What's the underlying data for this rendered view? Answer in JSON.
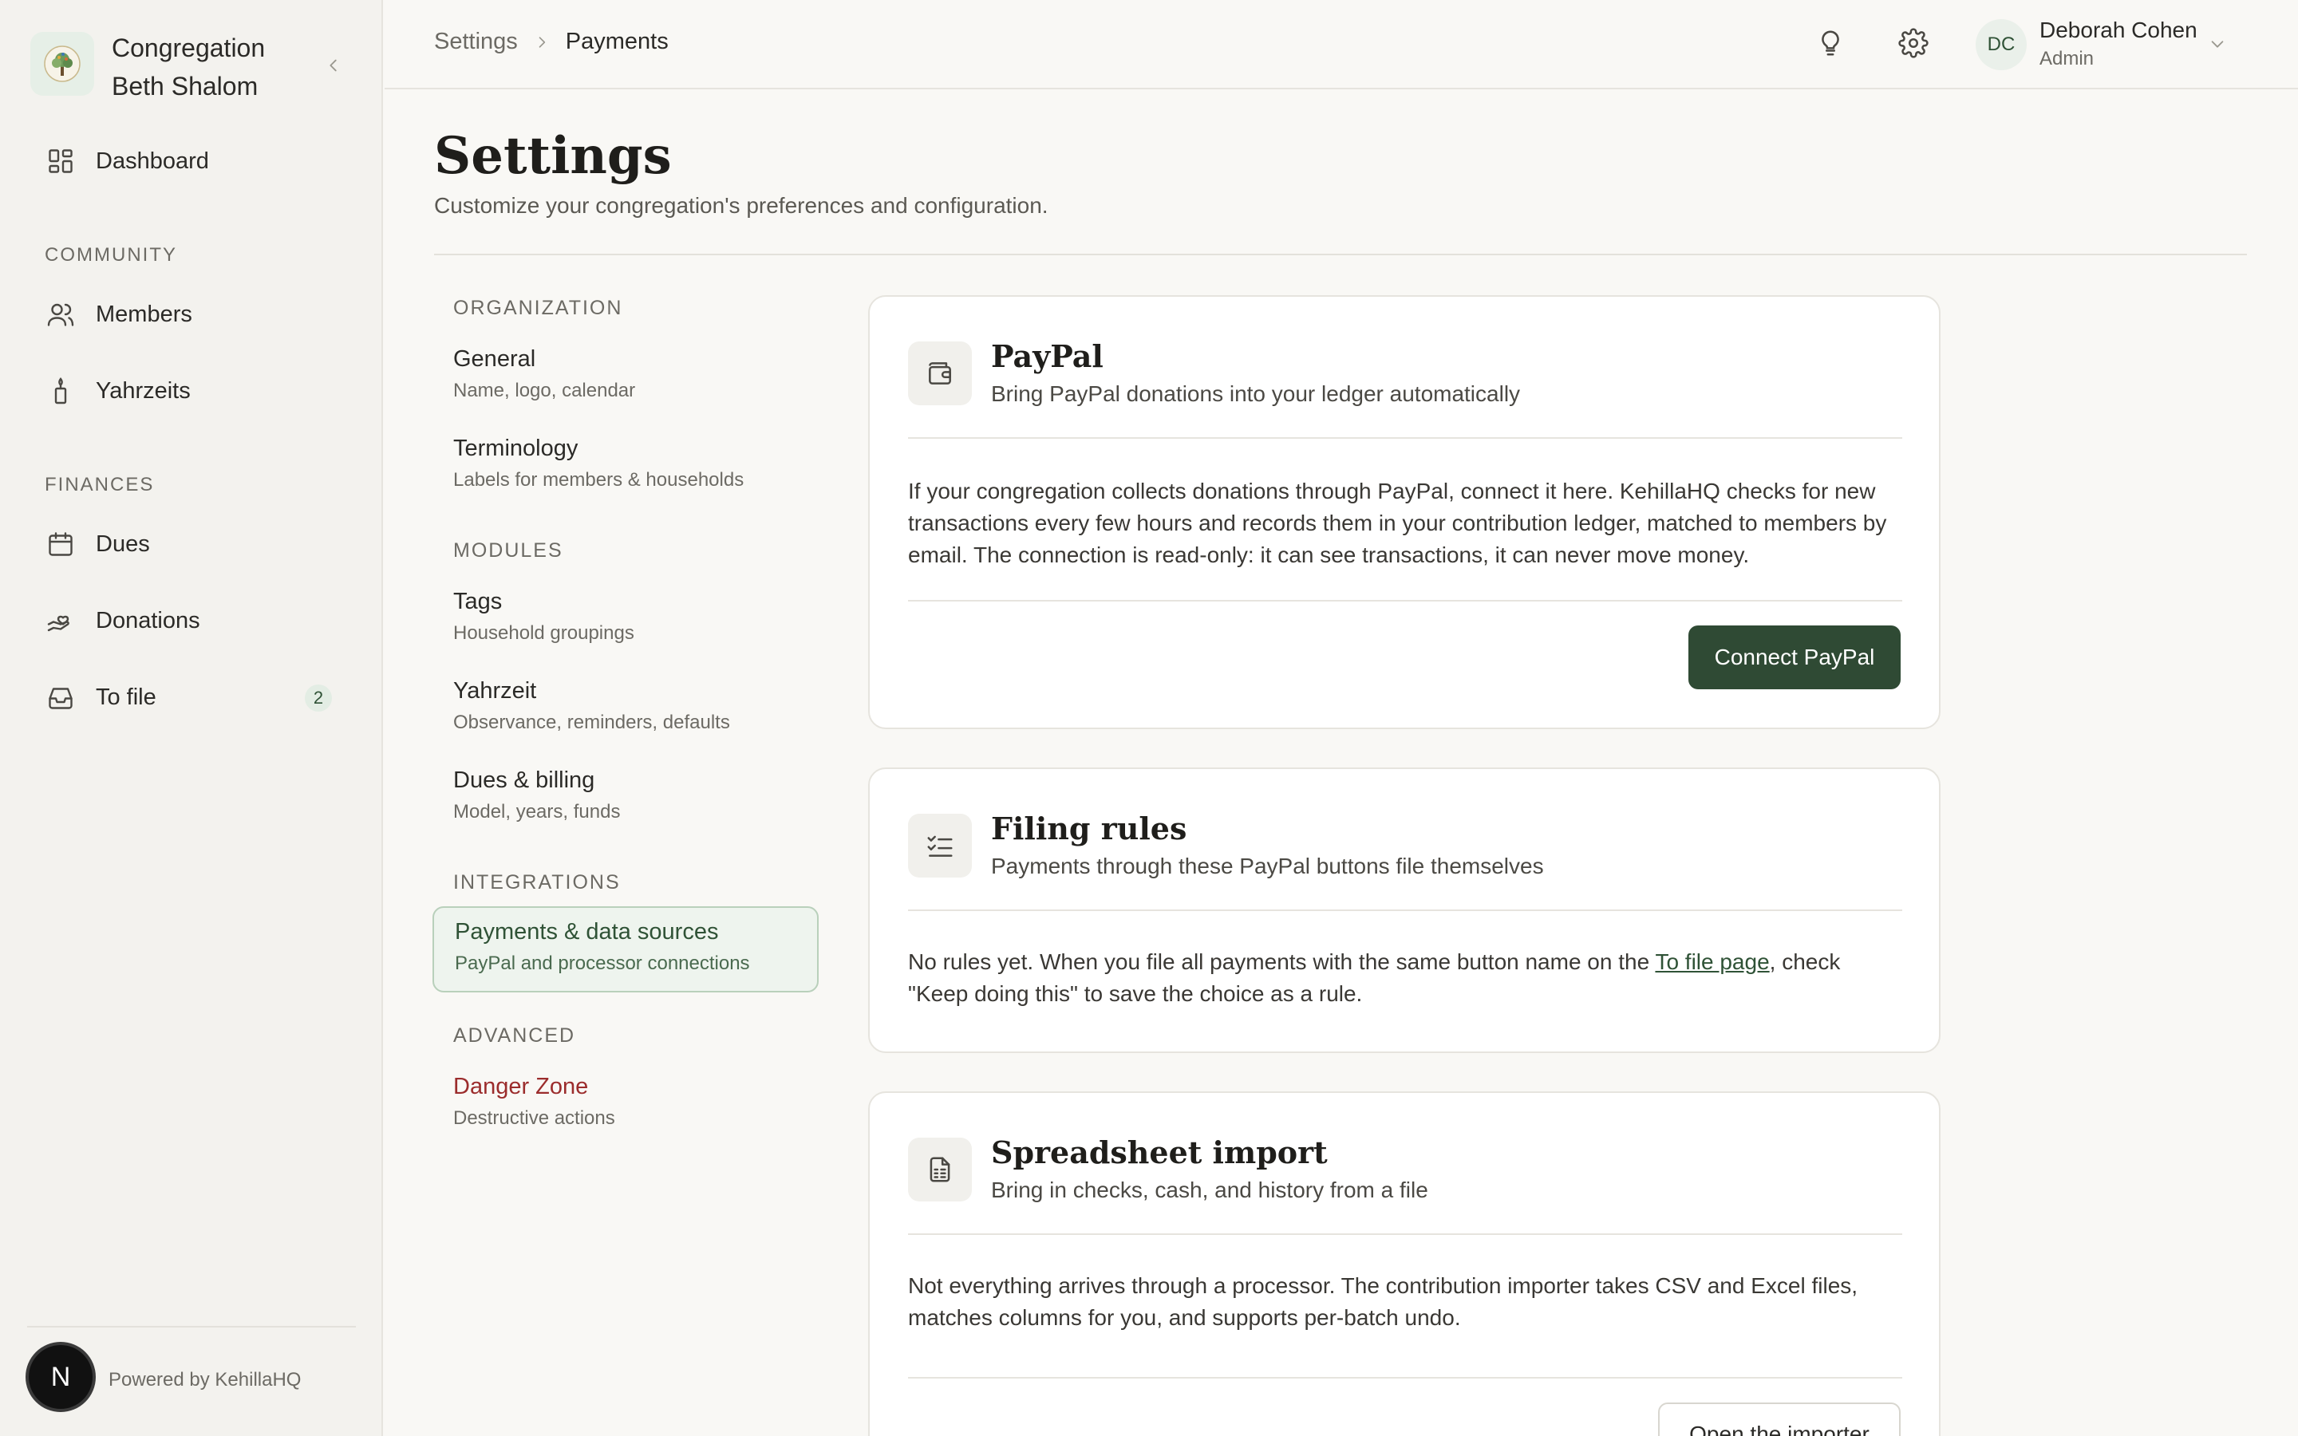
{
  "sidebar": {
    "org_name_line1": "Congregation",
    "org_name_line2": "Beth Shalom",
    "dashboard": "Dashboard",
    "section_community": "COMMUNITY",
    "members": "Members",
    "yahrzeits": "Yahrzeits",
    "section_finances": "FINANCES",
    "dues": "Dues",
    "donations": "Donations",
    "to_file": "To file",
    "to_file_count": "2",
    "avatar_letter": "N",
    "powered_by": "Powered by KehillaHQ"
  },
  "topbar": {
    "breadcrumb_root": "Settings",
    "breadcrumb_current": "Payments",
    "user_initials": "DC",
    "user_name": "Deborah Cohen",
    "user_role": "Admin"
  },
  "page": {
    "title": "Settings",
    "subtitle": "Customize your congregation's preferences and configuration."
  },
  "settings_nav": {
    "section_organization": "ORGANIZATION",
    "general_title": "General",
    "general_desc": "Name, logo, calendar",
    "terminology_title": "Terminology",
    "terminology_desc": "Labels for members & households",
    "section_modules": "MODULES",
    "tags_title": "Tags",
    "tags_desc": "Household groupings",
    "yahrzeit_title": "Yahrzeit",
    "yahrzeit_desc": "Observance, reminders, defaults",
    "dues_title": "Dues & billing",
    "dues_desc": "Model, years, funds",
    "section_integrations": "INTEGRATIONS",
    "payments_title": "Payments & data sources",
    "payments_desc": "PayPal and processor connections",
    "section_advanced": "ADVANCED",
    "danger_title": "Danger Zone",
    "danger_desc": "Destructive actions"
  },
  "cards": {
    "paypal": {
      "title": "PayPal",
      "subtitle": "Bring PayPal donations into your ledger automatically",
      "body": "If your congregation collects donations through PayPal, connect it here. KehillaHQ checks for new transactions every few hours and records them in your contribution ledger, matched to members by email. The connection is read-only: it can see transactions, it can never move money.",
      "button": "Connect PayPal"
    },
    "filing": {
      "title": "Filing rules",
      "subtitle": "Payments through these PayPal buttons file themselves",
      "body_before": "No rules yet. When you file all payments with the same button name on the ",
      "link": "To file page",
      "body_after": ", check \"Keep doing this\" to save the choice as a rule."
    },
    "spreadsheet": {
      "title": "Spreadsheet import",
      "subtitle": "Bring in checks, cash, and history from a file",
      "body": "Not everything arrives through a processor. The contribution importer takes CSV and Excel files, matches columns for you, and supports per-batch undo.",
      "button": "Open the importer"
    }
  },
  "colors": {
    "accent": "#2f4a34",
    "active_nav_bg": "#eef4ee",
    "danger": "#9b2c2c"
  }
}
